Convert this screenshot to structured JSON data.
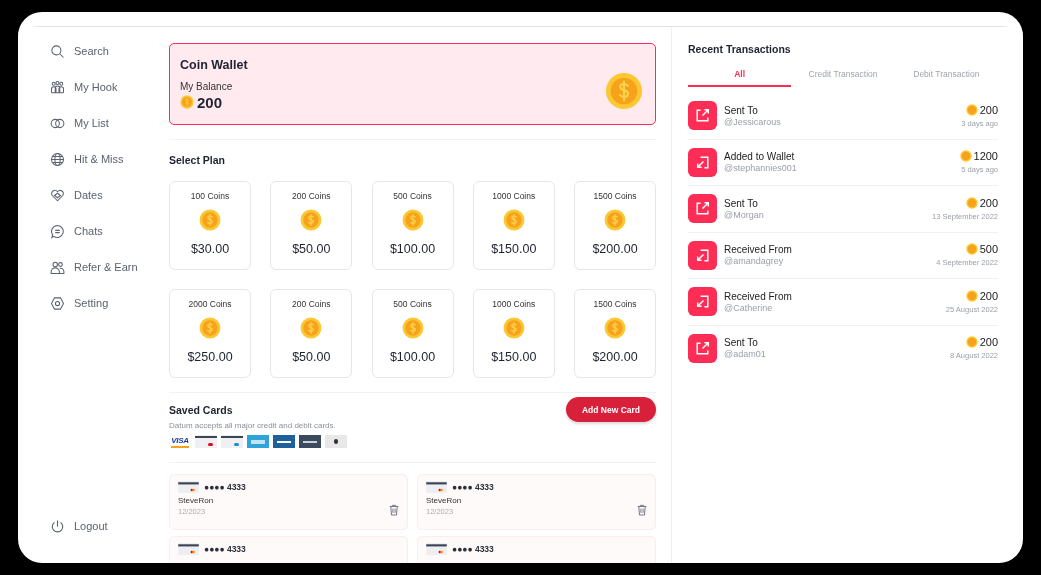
{
  "sidebar": {
    "items": [
      {
        "label": "Search",
        "kind": "search",
        "selected": false
      },
      {
        "label": "My Hook",
        "kind": "people",
        "selected": false
      },
      {
        "label": "My List",
        "kind": "rings",
        "selected": false
      },
      {
        "label": "Hit & Miss",
        "kind": "globe",
        "selected": false
      },
      {
        "label": "Dates",
        "kind": "heart",
        "selected": false
      },
      {
        "label": "Chats",
        "kind": "chat",
        "selected": false
      },
      {
        "label": "Refer & Earn",
        "kind": "users",
        "selected": false
      },
      {
        "label": "Setting",
        "kind": "hexagon",
        "selected": false
      }
    ],
    "logout": "Logout"
  },
  "wallet": {
    "title": "Coin Wallet",
    "balance_label": "My Balance",
    "balance": "200"
  },
  "plans": {
    "title": "Select Plan",
    "items": [
      {
        "coins": "100 Coins",
        "price": "$30.00"
      },
      {
        "coins": "200 Coins",
        "price": "$50.00"
      },
      {
        "coins": "500 Coins",
        "price": "$100.00"
      },
      {
        "coins": "1000 Coins",
        "price": "$150.00"
      },
      {
        "coins": "1500 Coins",
        "price": "$200.00"
      },
      {
        "coins": "2000 Coins",
        "price": "$250.00"
      },
      {
        "coins": "200 Coins",
        "price": "$50.00"
      },
      {
        "coins": "500 Coins",
        "price": "$100.00"
      },
      {
        "coins": "1000 Coins",
        "price": "$150.00"
      },
      {
        "coins": "1500 Coins",
        "price": "$200.00"
      }
    ]
  },
  "saved_cards": {
    "title": "Saved Cards",
    "subtitle": "Datum accepts all major credit and debit cards.",
    "add_button": "Add New Card",
    "brands": [
      {
        "kind": "visa",
        "label": "VISA"
      },
      {
        "kind": "mastercard"
      },
      {
        "kind": "maestro"
      },
      {
        "kind": "amex"
      },
      {
        "kind": "diners"
      },
      {
        "kind": "discover"
      },
      {
        "kind": "other"
      }
    ],
    "cards": [
      {
        "number": "●●●● 4333",
        "name": "SteveRon",
        "expiry": "12/2023"
      },
      {
        "number": "●●●● 4333",
        "name": "SteveRon",
        "expiry": "12/2023"
      },
      {
        "number": "●●●● 4333"
      },
      {
        "number": "●●●● 4333"
      }
    ]
  },
  "transactions": {
    "title": "Recent Transactions",
    "tabs": [
      {
        "label": "All",
        "selected": true
      },
      {
        "label": "Credit Transaction",
        "selected": false
      },
      {
        "label": "Debit Transaction",
        "selected": false
      }
    ],
    "items": [
      {
        "kind": "sent",
        "title": "Sent To",
        "user": "@Jessicarous",
        "amount": "200",
        "date": "3 days ago"
      },
      {
        "kind": "received",
        "title": "Added to Wallet",
        "user": "@stephannies001",
        "amount": "1200",
        "date": "5 days ago"
      },
      {
        "kind": "sent",
        "title": "Sent To",
        "user": "@Morgan",
        "amount": "200",
        "date": "13 September 2022"
      },
      {
        "kind": "received",
        "title": "Received From",
        "user": "@amandagrey",
        "amount": "500",
        "date": "4 September 2022"
      },
      {
        "kind": "received",
        "title": "Received From",
        "user": "@Catherine",
        "amount": "200",
        "date": "25 August 2022"
      },
      {
        "kind": "sent",
        "title": "Sent To",
        "user": "@adam01",
        "amount": "200",
        "date": "8 August 2022"
      }
    ]
  }
}
